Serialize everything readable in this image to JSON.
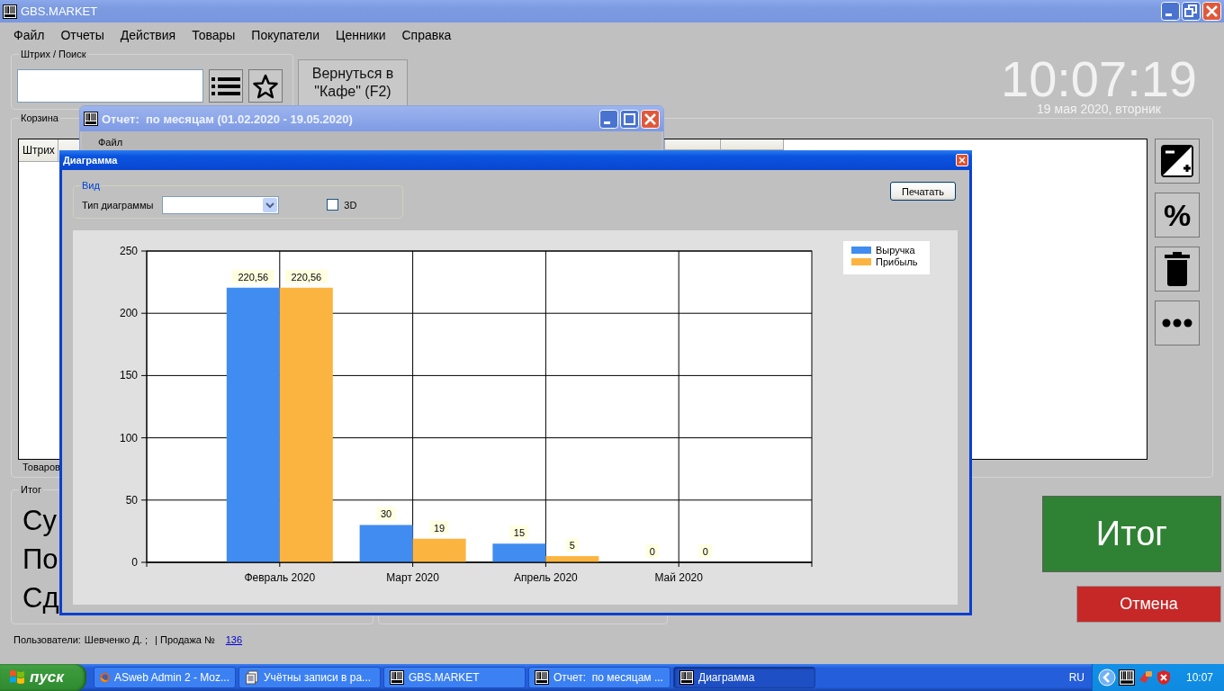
{
  "window": {
    "title": "GBS.MARKET"
  },
  "menu": [
    "Файл",
    "Отчеты",
    "Действия",
    "Товары",
    "Покупатели",
    "Ценники",
    "Справка"
  ],
  "search": {
    "label": "Штрих / Поиск"
  },
  "return_button": "Вернуться в \"Кафе\" (F2)",
  "clock": {
    "time": "10:07:19",
    "date": "19 мая 2020, вторник"
  },
  "cart": {
    "label": "Корзина",
    "columns": [
      "Штрих"
    ],
    "footer": "Товаров"
  },
  "side_buttons": [
    {
      "kind": "exposure"
    },
    {
      "kind": "percent",
      "text": "%"
    },
    {
      "kind": "delete"
    },
    {
      "kind": "more"
    }
  ],
  "total": {
    "label": "Итог",
    "lines": [
      "Су",
      "По",
      "Сд"
    ]
  },
  "total_button": "Итог",
  "cancel_button": "Отмена",
  "status_bar": {
    "users_label": "Пользователи:",
    "user": "Шевченко Д. ;",
    "sale_label": "| Продажа №",
    "sale_number": "136"
  },
  "report_window": {
    "title": "Отчет:  по месяцам (01.02.2020 - 19.05.2020)",
    "menu": [
      "Файл"
    ]
  },
  "chart_dialog": {
    "title": "Диаграмма",
    "view_group": "Вид",
    "chart_type_label": "Тип диаграммы",
    "three_d": {
      "label": "3D",
      "checked": false
    },
    "print_button": "Печатать",
    "chart_data": {
      "type": "bar",
      "categories": [
        "Февраль 2020",
        "Март 2020",
        "Апрель 2020",
        "Май 2020"
      ],
      "series": [
        {
          "name": "Выручка",
          "color": "#418cf0",
          "values": [
            220.56,
            30,
            15,
            0
          ]
        },
        {
          "name": "Прибыль",
          "color": "#fcb441",
          "values": [
            220.56,
            19,
            5,
            0
          ]
        }
      ],
      "ylim": [
        0,
        250
      ],
      "yticks": [
        0,
        50,
        100,
        150,
        200,
        250
      ],
      "grid": true,
      "legend": true,
      "value_labels": [
        [
          "220,56",
          "30",
          "15",
          "0"
        ],
        [
          "220,56",
          "19",
          "5",
          "0"
        ]
      ]
    }
  },
  "taskbar": {
    "start": "пуск",
    "tasks": [
      {
        "label": "ASweb Admin 2 - Moz...",
        "kind": "browser",
        "selected": false
      },
      {
        "label": "Учётны записи в ра...",
        "kind": "document",
        "selected": false
      },
      {
        "label": "GBS.MARKET",
        "kind": "app",
        "selected": false
      },
      {
        "label": "Отчет:  по месяцам ...",
        "kind": "app",
        "selected": false
      },
      {
        "label": "Диаграмма",
        "kind": "app",
        "selected": true
      }
    ],
    "language": "RU",
    "time": "10:07"
  }
}
